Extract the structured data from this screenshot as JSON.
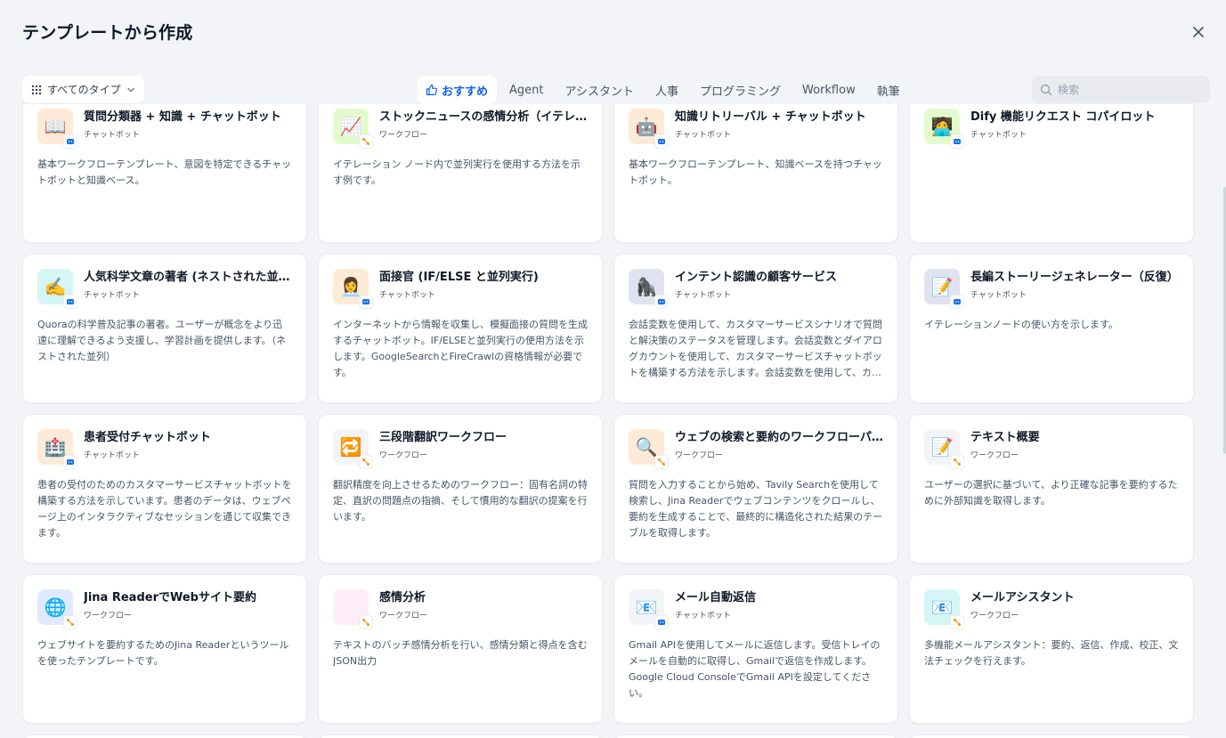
{
  "header": {
    "title": "テンプレートから作成"
  },
  "filter": {
    "type_label": "すべてのタイプ"
  },
  "tabs": [
    {
      "label": "おすすめ",
      "active": true
    },
    {
      "label": "Agent"
    },
    {
      "label": "アシスタント"
    },
    {
      "label": "人事"
    },
    {
      "label": "プログラミング"
    },
    {
      "label": "Workflow"
    },
    {
      "label": "執筆"
    }
  ],
  "search": {
    "placeholder": "検索"
  },
  "colors": {
    "accent": "#155eef",
    "chatbot_badge": "#1570ef",
    "workflow_badge": "#f79009"
  },
  "cards": [
    {
      "title": "質問分類器 + 知識 + チャットボット",
      "mode": "チャットボット",
      "mode_key": "chat",
      "icon": "📖",
      "icon_name": "book-icon",
      "bg": "#fdead7",
      "desc": "基本ワークフローテンプレート、意図を特定できるチャットボットと知識ベース。"
    },
    {
      "title": "ストックニュースの感情分析（イテレーション）",
      "mode": "ワークフロー",
      "mode_key": "workflow",
      "icon": "📈",
      "icon_name": "chart-up-icon",
      "bg": "#e3fbcc",
      "desc": "イテレーション ノード内で並列実行を使用する方法を示す例です。"
    },
    {
      "title": "知識リトリーバル + チャットボット",
      "mode": "チャットボット",
      "mode_key": "chat",
      "icon": "🤖",
      "icon_name": "robot-icon",
      "bg": "#fdead7",
      "desc": "基本ワークフローテンプレート、知識ベースを持つチャットボット。"
    },
    {
      "title": "Dify 機能リクエスト コパイロット",
      "mode": "チャットボット",
      "mode_key": "chat",
      "icon": "🧑‍💻",
      "icon_name": "technologist-icon",
      "bg": "#e3fbcc",
      "desc": ""
    },
    {
      "title": "人気科学文章の著者 (ネストされた並列)",
      "mode": "チャットボット",
      "mode_key": "chat",
      "icon": "✍️",
      "icon_name": "writing-hand-icon",
      "bg": "#d5f5f6",
      "desc": "Quoraの科学普及記事の著者。ユーザーが概念をより迅速に理解できるよう支援し、学習計画を提供します。（ネストされた並列）"
    },
    {
      "title": "面接官 (IF/ELSE と並列実行)",
      "mode": "チャットボット",
      "mode_key": "chat",
      "icon": "👩‍💼",
      "icon_name": "office-worker-icon",
      "bg": "#fdead7",
      "desc": "インターネットから情報を収集し、模擬面接の質問を生成するチャットボット。IF/ELSEと並列実行の使用方法を示します。GoogleSearchとFireCrawlの資格情報が必要です。"
    },
    {
      "title": "インテント認識の顧客サービス",
      "mode": "チャットボット",
      "mode_key": "chat",
      "icon": "🦍",
      "icon_name": "gorilla-icon",
      "bg": "#e0e2ef",
      "desc": "会話変数を使用して、カスタマーサービスシナリオで質問と解決策のステータスを管理します。会話変数とダイアログカウントを使用して、カスタマーサービスチャットボットを構築する方法を示します。会話変数を使用して、カスタマーサービスシナリオで質問と解決策のステータスを管理します。"
    },
    {
      "title": "長編ストーリージェネレーター（反復）",
      "mode": "チャットボット",
      "mode_key": "chat",
      "icon": "📝",
      "icon_name": "memo-icon",
      "bg": "#e0e2ef",
      "desc": "イテレーションノードの使い方を示します。"
    },
    {
      "title": "患者受付チャットボット",
      "mode": "チャットボット",
      "mode_key": "chat",
      "icon": "🏥",
      "icon_name": "hospital-icon",
      "bg": "#fdead7",
      "desc": "患者の受付のためのカスタマーサービスチャットボットを構築する方法を示しています。患者のデータは、ウェブページ上のインタラクティブなセッションを通じて収集できます。"
    },
    {
      "title": "三段階翻訳ワークフロー",
      "mode": "ワークフロー",
      "mode_key": "workflow",
      "icon": "🔁",
      "icon_name": "repeat-icon",
      "bg": "#f2f4f7",
      "desc": "翻訳精度を向上させるためのワークフロー：固有名詞の特定、直訳の問題点の指摘、そして慣用的な翻訳の提案を行います。"
    },
    {
      "title": "ウェブの検索と要約のワークフローパターン",
      "mode": "ワークフロー",
      "mode_key": "workflow",
      "icon": "🔍",
      "icon_name": "magnifier-icon",
      "bg": "#fdead7",
      "desc": "質問を入力することから始め、Tavily Searchを使用して検索し、Jina Readerでウェブコンテンツをクロールし、要約を生成することで、最終的に構造化された結果のテーブルを取得します。"
    },
    {
      "title": "テキスト概要",
      "mode": "ワークフロー",
      "mode_key": "workflow",
      "icon": "📝",
      "icon_name": "memo-icon",
      "bg": "#f2f4f7",
      "desc": "ユーザーの選択に基づいて、より正確な記事を要約するために外部知識を取得します。"
    },
    {
      "title": "Jina ReaderでWebサイト要約",
      "mode": "ワークフロー",
      "mode_key": "workflow",
      "icon": "🌐",
      "icon_name": "globe-icon",
      "bg": "#e0eaff",
      "desc": "ウェブサイトを要約するためのJina Readerというツールを使ったテンプレートです。"
    },
    {
      "title": "感情分析",
      "mode": "ワークフロー",
      "mode_key": "workflow",
      "icon": "",
      "icon_name": "blank-icon",
      "bg": "#fdeef7",
      "desc": "テキストのバッチ感情分析を行い、感情分類と得点を含むJSON出力"
    },
    {
      "title": "メール自動返信",
      "mode": "チャットボット",
      "mode_key": "chat",
      "icon": "📧",
      "icon_name": "email-icon",
      "bg": "#f2f4f7",
      "desc": "Gmail APIを使用してメールに返信します。受信トレイのメールを自動的に取得し、Gmailで返信を作成します。Google Cloud ConsoleでGmail APIを設定してください。"
    },
    {
      "title": "メールアシスタント",
      "mode": "ワークフロー",
      "mode_key": "workflow",
      "icon": "📧",
      "icon_name": "email-icon",
      "bg": "#d5f5f6",
      "desc": "多機能メールアシスタント：要約、返信、作成、校正、文法チェックを行えます。"
    }
  ]
}
